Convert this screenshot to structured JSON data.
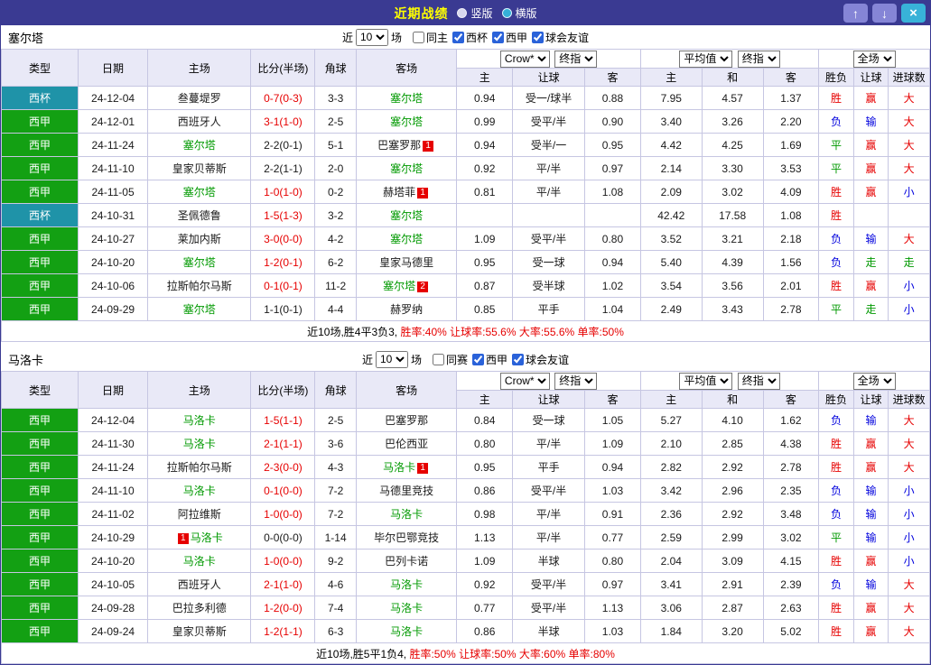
{
  "topbar": {
    "title": "近期战绩",
    "radios": [
      {
        "label": "竖版",
        "selected": false
      },
      {
        "label": "横版",
        "selected": true
      }
    ],
    "up_label": "↑",
    "down_label": "↓",
    "close_label": "×"
  },
  "table_columns": {
    "type": "类型",
    "date": "日期",
    "home": "主场",
    "score": "比分(半场)",
    "corner": "角球",
    "away": "客场",
    "odds_home": "主",
    "odds_handicap": "让球",
    "odds_away": "客",
    "avg_home": "主",
    "avg_draw": "和",
    "avg_away": "客",
    "result": "胜负",
    "handicap_result": "让球",
    "goals": "进球数"
  },
  "sections": [
    {
      "team": "塞尔塔",
      "filter": {
        "near": "近",
        "count": "10",
        "unit": "场",
        "checkboxes": [
          {
            "label": "同主",
            "checked": false
          },
          {
            "label": "西杯",
            "checked": true
          },
          {
            "label": "西甲",
            "checked": true
          },
          {
            "label": "球会友谊",
            "checked": true
          }
        ]
      },
      "selects": {
        "provider": "Crow*",
        "provider_time": "终指",
        "avg": "平均值",
        "avg_time": "终指",
        "scope": "全场"
      },
      "rows": [
        {
          "type": "西杯",
          "type_cls": "bg-cup",
          "date": "24-12-04",
          "home_pre": "",
          "home": "叁蔓堤罗",
          "home_post": "",
          "home_cls": "",
          "score": "0-7(0-3)",
          "score_cls": "t-red",
          "corner": "3-3",
          "away_pre": "",
          "away": "塞尔塔",
          "away_post": "",
          "away_cls": "t-green",
          "o_home": "0.94",
          "o_hcap": "受一/球半",
          "o_away": "0.88",
          "a_home": "7.95",
          "a_draw": "4.57",
          "a_away": "1.37",
          "res": "胜",
          "res_cls": "t-red",
          "hres": "赢",
          "hres_cls": "t-red",
          "goals": "大",
          "goals_cls": "t-red"
        },
        {
          "type": "西甲",
          "type_cls": "bg-liga",
          "date": "24-12-01",
          "home_pre": "",
          "home": "西班牙人",
          "home_post": "",
          "home_cls": "",
          "score": "3-1(1-0)",
          "score_cls": "t-red",
          "corner": "2-5",
          "away_pre": "",
          "away": "塞尔塔",
          "away_post": "",
          "away_cls": "t-green",
          "o_home": "0.99",
          "o_hcap": "受平/半",
          "o_away": "0.90",
          "a_home": "3.40",
          "a_draw": "3.26",
          "a_away": "2.20",
          "res": "负",
          "res_cls": "t-blue",
          "hres": "输",
          "hres_cls": "t-blue",
          "goals": "大",
          "goals_cls": "t-red"
        },
        {
          "type": "西甲",
          "type_cls": "bg-liga",
          "date": "24-11-24",
          "home_pre": "",
          "home": "塞尔塔",
          "home_post": "",
          "home_cls": "t-green",
          "score": "2-2(0-1)",
          "score_cls": "",
          "corner": "5-1",
          "away_pre": "",
          "away": "巴塞罗那",
          "away_post": "1",
          "away_cls": "",
          "o_home": "0.94",
          "o_hcap": "受半/一",
          "o_away": "0.95",
          "a_home": "4.42",
          "a_draw": "4.25",
          "a_away": "1.69",
          "res": "平",
          "res_cls": "t-green",
          "hres": "赢",
          "hres_cls": "t-red",
          "goals": "大",
          "goals_cls": "t-red"
        },
        {
          "type": "西甲",
          "type_cls": "bg-liga",
          "date": "24-11-10",
          "home_pre": "",
          "home": "皇家贝蒂斯",
          "home_post": "",
          "home_cls": "",
          "score": "2-2(1-1)",
          "score_cls": "",
          "corner": "2-0",
          "away_pre": "",
          "away": "塞尔塔",
          "away_post": "",
          "away_cls": "t-green",
          "o_home": "0.92",
          "o_hcap": "平/半",
          "o_away": "0.97",
          "a_home": "2.14",
          "a_draw": "3.30",
          "a_away": "3.53",
          "res": "平",
          "res_cls": "t-green",
          "hres": "赢",
          "hres_cls": "t-red",
          "goals": "大",
          "goals_cls": "t-red"
        },
        {
          "type": "西甲",
          "type_cls": "bg-liga",
          "date": "24-11-05",
          "home_pre": "",
          "home": "塞尔塔",
          "home_post": "",
          "home_cls": "t-green",
          "score": "1-0(1-0)",
          "score_cls": "t-red",
          "corner": "0-2",
          "away_pre": "",
          "away": "赫塔菲",
          "away_post": "1",
          "away_cls": "",
          "o_home": "0.81",
          "o_hcap": "平/半",
          "o_away": "1.08",
          "a_home": "2.09",
          "a_draw": "3.02",
          "a_away": "4.09",
          "res": "胜",
          "res_cls": "t-red",
          "hres": "赢",
          "hres_cls": "t-red",
          "goals": "小",
          "goals_cls": "t-blue"
        },
        {
          "type": "西杯",
          "type_cls": "bg-cup",
          "date": "24-10-31",
          "home_pre": "",
          "home": "圣佩德鲁",
          "home_post": "",
          "home_cls": "",
          "score": "1-5(1-3)",
          "score_cls": "t-red",
          "corner": "3-2",
          "away_pre": "",
          "away": "塞尔塔",
          "away_post": "",
          "away_cls": "t-green",
          "o_home": "",
          "o_hcap": "",
          "o_away": "",
          "a_home": "42.42",
          "a_draw": "17.58",
          "a_away": "1.08",
          "res": "胜",
          "res_cls": "t-red",
          "hres": "",
          "hres_cls": "",
          "goals": "",
          "goals_cls": ""
        },
        {
          "type": "西甲",
          "type_cls": "bg-liga",
          "date": "24-10-27",
          "home_pre": "",
          "home": "莱加内斯",
          "home_post": "",
          "home_cls": "",
          "score": "3-0(0-0)",
          "score_cls": "t-red",
          "corner": "4-2",
          "away_pre": "",
          "away": "塞尔塔",
          "away_post": "",
          "away_cls": "t-green",
          "o_home": "1.09",
          "o_hcap": "受平/半",
          "o_away": "0.80",
          "a_home": "3.52",
          "a_draw": "3.21",
          "a_away": "2.18",
          "res": "负",
          "res_cls": "t-blue",
          "hres": "输",
          "hres_cls": "t-blue",
          "goals": "大",
          "goals_cls": "t-red"
        },
        {
          "type": "西甲",
          "type_cls": "bg-liga",
          "date": "24-10-20",
          "home_pre": "",
          "home": "塞尔塔",
          "home_post": "",
          "home_cls": "t-green",
          "score": "1-2(0-1)",
          "score_cls": "t-red",
          "corner": "6-2",
          "away_pre": "",
          "away": "皇家马德里",
          "away_post": "",
          "away_cls": "",
          "o_home": "0.95",
          "o_hcap": "受一球",
          "o_away": "0.94",
          "a_home": "5.40",
          "a_draw": "4.39",
          "a_away": "1.56",
          "res": "负",
          "res_cls": "t-blue",
          "hres": "走",
          "hres_cls": "t-green",
          "goals": "走",
          "goals_cls": "t-green"
        },
        {
          "type": "西甲",
          "type_cls": "bg-liga",
          "date": "24-10-06",
          "home_pre": "",
          "home": "拉斯帕尔马斯",
          "home_post": "",
          "home_cls": "",
          "score": "0-1(0-1)",
          "score_cls": "t-red",
          "corner": "11-2",
          "away_pre": "",
          "away": "塞尔塔",
          "away_post": "2",
          "away_cls": "t-green",
          "o_home": "0.87",
          "o_hcap": "受半球",
          "o_away": "1.02",
          "a_home": "3.54",
          "a_draw": "3.56",
          "a_away": "2.01",
          "res": "胜",
          "res_cls": "t-red",
          "hres": "赢",
          "hres_cls": "t-red",
          "goals": "小",
          "goals_cls": "t-blue"
        },
        {
          "type": "西甲",
          "type_cls": "bg-liga",
          "date": "24-09-29",
          "home_pre": "",
          "home": "塞尔塔",
          "home_post": "",
          "home_cls": "t-green",
          "score": "1-1(0-1)",
          "score_cls": "",
          "corner": "4-4",
          "away_pre": "",
          "away": "赫罗纳",
          "away_post": "",
          "away_cls": "",
          "o_home": "0.85",
          "o_hcap": "平手",
          "o_away": "1.04",
          "a_home": "2.49",
          "a_draw": "3.43",
          "a_away": "2.78",
          "res": "平",
          "res_cls": "t-green",
          "hres": "走",
          "hres_cls": "t-green",
          "goals": "小",
          "goals_cls": "t-blue"
        }
      ],
      "summary": {
        "prefix": "近10场,胜4平3负3, ",
        "stats": "胜率:40% 让球率:55.6% 大率:55.6% 单率:50%"
      }
    },
    {
      "team": "马洛卡",
      "filter": {
        "near": "近",
        "count": "10",
        "unit": "场",
        "checkboxes": [
          {
            "label": "同赛",
            "checked": false
          },
          {
            "label": "西甲",
            "checked": true
          },
          {
            "label": "球会友谊",
            "checked": true
          }
        ]
      },
      "selects": {
        "provider": "Crow*",
        "provider_time": "终指",
        "avg": "平均值",
        "avg_time": "终指",
        "scope": "全场"
      },
      "rows": [
        {
          "type": "西甲",
          "type_cls": "bg-liga",
          "date": "24-12-04",
          "home_pre": "",
          "home": "马洛卡",
          "home_post": "",
          "home_cls": "t-green",
          "score": "1-5(1-1)",
          "score_cls": "t-red",
          "corner": "2-5",
          "away_pre": "",
          "away": "巴塞罗那",
          "away_post": "",
          "away_cls": "",
          "o_home": "0.84",
          "o_hcap": "受一球",
          "o_away": "1.05",
          "a_home": "5.27",
          "a_draw": "4.10",
          "a_away": "1.62",
          "res": "负",
          "res_cls": "t-blue",
          "hres": "输",
          "hres_cls": "t-blue",
          "goals": "大",
          "goals_cls": "t-red"
        },
        {
          "type": "西甲",
          "type_cls": "bg-liga",
          "date": "24-11-30",
          "home_pre": "",
          "home": "马洛卡",
          "home_post": "",
          "home_cls": "t-green",
          "score": "2-1(1-1)",
          "score_cls": "t-red",
          "corner": "3-6",
          "away_pre": "",
          "away": "巴伦西亚",
          "away_post": "",
          "away_cls": "",
          "o_home": "0.80",
          "o_hcap": "平/半",
          "o_away": "1.09",
          "a_home": "2.10",
          "a_draw": "2.85",
          "a_away": "4.38",
          "res": "胜",
          "res_cls": "t-red",
          "hres": "赢",
          "hres_cls": "t-red",
          "goals": "大",
          "goals_cls": "t-red"
        },
        {
          "type": "西甲",
          "type_cls": "bg-liga",
          "date": "24-11-24",
          "home_pre": "",
          "home": "拉斯帕尔马斯",
          "home_post": "",
          "home_cls": "",
          "score": "2-3(0-0)",
          "score_cls": "t-red",
          "corner": "4-3",
          "away_pre": "",
          "away": "马洛卡",
          "away_post": "1",
          "away_cls": "t-green",
          "o_home": "0.95",
          "o_hcap": "平手",
          "o_away": "0.94",
          "a_home": "2.82",
          "a_draw": "2.92",
          "a_away": "2.78",
          "res": "胜",
          "res_cls": "t-red",
          "hres": "赢",
          "hres_cls": "t-red",
          "goals": "大",
          "goals_cls": "t-red"
        },
        {
          "type": "西甲",
          "type_cls": "bg-liga",
          "date": "24-11-10",
          "home_pre": "",
          "home": "马洛卡",
          "home_post": "",
          "home_cls": "t-green",
          "score": "0-1(0-0)",
          "score_cls": "t-red",
          "corner": "7-2",
          "away_pre": "",
          "away": "马德里竞技",
          "away_post": "",
          "away_cls": "",
          "o_home": "0.86",
          "o_hcap": "受平/半",
          "o_away": "1.03",
          "a_home": "3.42",
          "a_draw": "2.96",
          "a_away": "2.35",
          "res": "负",
          "res_cls": "t-blue",
          "hres": "输",
          "hres_cls": "t-blue",
          "goals": "小",
          "goals_cls": "t-blue"
        },
        {
          "type": "西甲",
          "type_cls": "bg-liga",
          "date": "24-11-02",
          "home_pre": "",
          "home": "阿拉维斯",
          "home_post": "",
          "home_cls": "",
          "score": "1-0(0-0)",
          "score_cls": "t-red",
          "corner": "7-2",
          "away_pre": "",
          "away": "马洛卡",
          "away_post": "",
          "away_cls": "t-green",
          "o_home": "0.98",
          "o_hcap": "平/半",
          "o_away": "0.91",
          "a_home": "2.36",
          "a_draw": "2.92",
          "a_away": "3.48",
          "res": "负",
          "res_cls": "t-blue",
          "hres": "输",
          "hres_cls": "t-blue",
          "goals": "小",
          "goals_cls": "t-blue"
        },
        {
          "type": "西甲",
          "type_cls": "bg-liga",
          "date": "24-10-29",
          "home_pre": "1",
          "home": "马洛卡",
          "home_post": "",
          "home_cls": "t-green",
          "score": "0-0(0-0)",
          "score_cls": "",
          "corner": "1-14",
          "away_pre": "",
          "away": "毕尔巴鄂竞技",
          "away_post": "",
          "away_cls": "",
          "o_home": "1.13",
          "o_hcap": "平/半",
          "o_away": "0.77",
          "a_home": "2.59",
          "a_draw": "2.99",
          "a_away": "3.02",
          "res": "平",
          "res_cls": "t-green",
          "hres": "输",
          "hres_cls": "t-blue",
          "goals": "小",
          "goals_cls": "t-blue"
        },
        {
          "type": "西甲",
          "type_cls": "bg-liga",
          "date": "24-10-20",
          "home_pre": "",
          "home": "马洛卡",
          "home_post": "",
          "home_cls": "t-green",
          "score": "1-0(0-0)",
          "score_cls": "t-red",
          "corner": "9-2",
          "away_pre": "",
          "away": "巴列卡诺",
          "away_post": "",
          "away_cls": "",
          "o_home": "1.09",
          "o_hcap": "半球",
          "o_away": "0.80",
          "a_home": "2.04",
          "a_draw": "3.09",
          "a_away": "4.15",
          "res": "胜",
          "res_cls": "t-red",
          "hres": "赢",
          "hres_cls": "t-red",
          "goals": "小",
          "goals_cls": "t-blue"
        },
        {
          "type": "西甲",
          "type_cls": "bg-liga",
          "date": "24-10-05",
          "home_pre": "",
          "home": "西班牙人",
          "home_post": "",
          "home_cls": "",
          "score": "2-1(1-0)",
          "score_cls": "t-red",
          "corner": "4-6",
          "away_pre": "",
          "away": "马洛卡",
          "away_post": "",
          "away_cls": "t-green",
          "o_home": "0.92",
          "o_hcap": "受平/半",
          "o_away": "0.97",
          "a_home": "3.41",
          "a_draw": "2.91",
          "a_away": "2.39",
          "res": "负",
          "res_cls": "t-blue",
          "hres": "输",
          "hres_cls": "t-blue",
          "goals": "大",
          "goals_cls": "t-red"
        },
        {
          "type": "西甲",
          "type_cls": "bg-liga",
          "date": "24-09-28",
          "home_pre": "",
          "home": "巴拉多利德",
          "home_post": "",
          "home_cls": "",
          "score": "1-2(0-0)",
          "score_cls": "t-red",
          "corner": "7-4",
          "away_pre": "",
          "away": "马洛卡",
          "away_post": "",
          "away_cls": "t-green",
          "o_home": "0.77",
          "o_hcap": "受平/半",
          "o_away": "1.13",
          "a_home": "3.06",
          "a_draw": "2.87",
          "a_away": "2.63",
          "res": "胜",
          "res_cls": "t-red",
          "hres": "赢",
          "hres_cls": "t-red",
          "goals": "大",
          "goals_cls": "t-red"
        },
        {
          "type": "西甲",
          "type_cls": "bg-liga",
          "date": "24-09-24",
          "home_pre": "",
          "home": "皇家贝蒂斯",
          "home_post": "",
          "home_cls": "",
          "score": "1-2(1-1)",
          "score_cls": "t-red",
          "corner": "6-3",
          "away_pre": "",
          "away": "马洛卡",
          "away_post": "",
          "away_cls": "t-green",
          "o_home": "0.86",
          "o_hcap": "半球",
          "o_away": "1.03",
          "a_home": "1.84",
          "a_draw": "3.20",
          "a_away": "5.02",
          "res": "胜",
          "res_cls": "t-red",
          "hres": "赢",
          "hres_cls": "t-red",
          "goals": "大",
          "goals_cls": "t-red"
        }
      ],
      "summary": {
        "prefix": "近10场,胜5平1负4, ",
        "stats": "胜率:50% 让球率:50% 大率:60% 单率:80%"
      }
    }
  ]
}
